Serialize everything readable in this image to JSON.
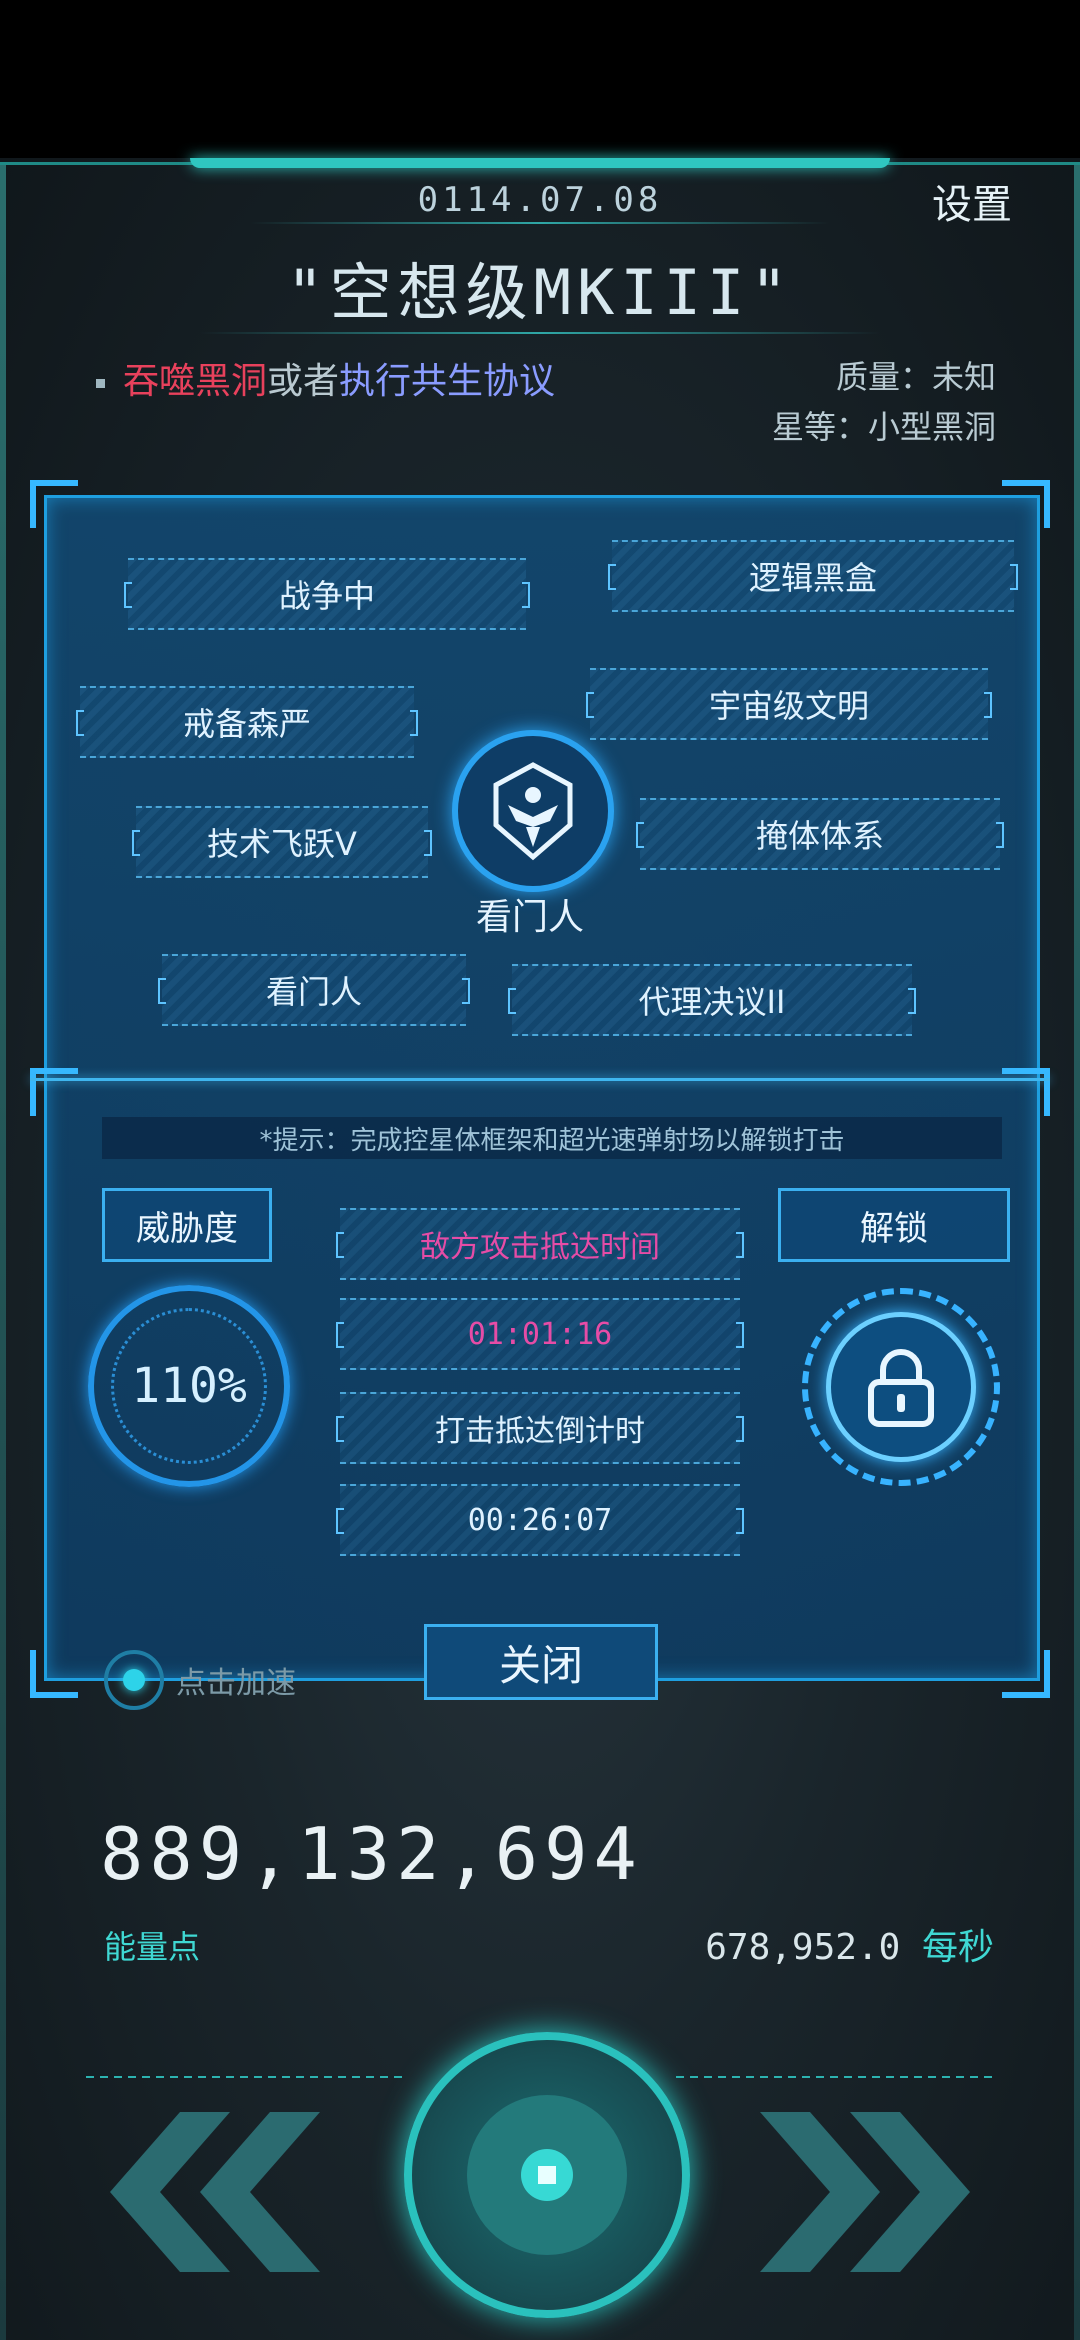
{
  "header": {
    "date": "0114.07.08",
    "settings_label": "设置",
    "ship_title": "\"空想级MKIII\""
  },
  "mission": {
    "part1": "吞噬黑洞",
    "part2": "或者",
    "part3": "执行共生协议"
  },
  "target": {
    "mass": "质量：未知",
    "star_grade": "星等：小型黑洞"
  },
  "tags": [
    "战争中",
    "逻辑黑盒",
    "戒备森严",
    "宇宙级文明",
    "技术飞跃V",
    "掩体体系",
    "看门人",
    "代理决议II"
  ],
  "emblem_label": "看门人",
  "hint": "*提示：完成控星体框架和超光速弹射场以解锁打击",
  "threat": {
    "label": "威胁度",
    "value": "110%"
  },
  "unlock_label": "解锁",
  "info": {
    "enemy_arrival_label": "敌方攻击抵达时间",
    "enemy_arrival_time": "01:01:16",
    "strike_countdown_label": "打击抵达倒计时",
    "strike_countdown_time": "00:26:07"
  },
  "close_label": "关闭",
  "accelerate_label": "点击加速",
  "energy": {
    "amount": "889,132,694",
    "label": "能量点",
    "rate": "678,952.0",
    "rate_unit": "每秒"
  },
  "colors": {
    "accent_teal": "#2fc6c0",
    "panel_blue": "#1e9fe0",
    "danger_red": "#e8415c",
    "protocol_blue": "#8a9cff",
    "timer_pink": "#e64ca6"
  }
}
